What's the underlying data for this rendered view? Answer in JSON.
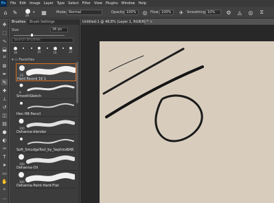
{
  "app": {
    "logo": "Ps"
  },
  "menu": [
    "File",
    "Edit",
    "Image",
    "Layer",
    "Type",
    "Select",
    "Filter",
    "View",
    "Plugins",
    "Window",
    "Help"
  ],
  "options": {
    "brush_size": "26",
    "mode_label": "Mode:",
    "mode_value": "Normal",
    "opacity_label": "Opacity:",
    "opacity_value": "100%",
    "flow_label": "Flow:",
    "flow_value": "100%",
    "smoothing_label": "Smoothing:",
    "smoothing_value": "10%"
  },
  "panel": {
    "tabs": [
      "Brushes",
      "Brush Settings"
    ],
    "size_label": "Size",
    "size_value": "26 px",
    "size_fraction": 0.35,
    "search_placeholder": "Search Brushes",
    "recent_numbers": [
      "30",
      "",
      "",
      "25",
      "",
      "16",
      "",
      "27"
    ],
    "folder_label": "Favorites",
    "brushes": [
      {
        "num": "25",
        "name": "Hard Round 16 1",
        "selected": true
      },
      {
        "num": "9",
        "name": "SmoothSketch",
        "selected": false
      },
      {
        "num": "",
        "name": "Hen HB Pencil",
        "selected": false
      },
      {
        "num": "100",
        "name": "Dehanna-blender",
        "selected": false
      },
      {
        "num": "",
        "name": "Soft_SmudgeTool_by_SephiroBAB",
        "selected": false
      },
      {
        "num": "160",
        "name": "Dehanna-Oil",
        "selected": false
      },
      {
        "num": "300",
        "name": "Dehanna-Paint-Hard-Flat",
        "selected": false
      }
    ]
  },
  "document": {
    "tab_title": "Untitled-1 @ 48,8% (Layer 1, RGB/8) *",
    "close_glyph": "×"
  },
  "colors": {
    "canvas": "#d8cdbd",
    "accent": "#d76e20",
    "ui_dark": "#3c3c3c"
  }
}
